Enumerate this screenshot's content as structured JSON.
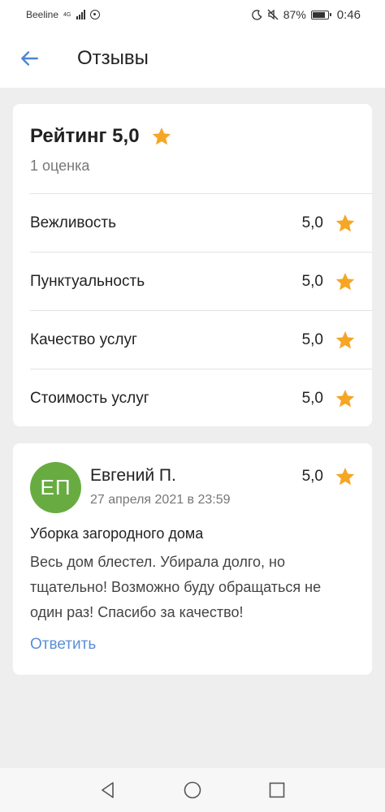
{
  "status_bar": {
    "carrier": "Beeline",
    "network_type": "4G",
    "battery_percent": "87%",
    "battery_level": 0.87,
    "time": "0:46"
  },
  "header": {
    "title": "Отзывы",
    "back_icon": "arrow-left-icon"
  },
  "rating_summary": {
    "title": "Рейтинг 5,0",
    "count": "1 оценка",
    "criteria": [
      {
        "label": "Вежливость",
        "value": "5,0"
      },
      {
        "label": "Пунктуальность",
        "value": "5,0"
      },
      {
        "label": "Качество услуг",
        "value": "5,0"
      },
      {
        "label": "Стоимость услуг",
        "value": "5,0"
      }
    ]
  },
  "review": {
    "avatar_initials": "ЕП",
    "author": "Евгений П.",
    "date": "27 апреля 2021 в 23:59",
    "rating": "5,0",
    "service": "Уборка загородного дома",
    "text": "Весь дом блестел. Убирала долго, но тщательно! Возможно буду обращаться не один раз! Спасибо за качество!",
    "reply_label": "Ответить"
  },
  "colors": {
    "accent": "#5b8fd6",
    "star": "#f5a623",
    "avatar": "#68ac41",
    "background": "#eeeeee"
  },
  "nav_bar": {
    "icons": [
      "back-triangle-icon",
      "home-circle-icon",
      "recents-square-icon"
    ]
  }
}
